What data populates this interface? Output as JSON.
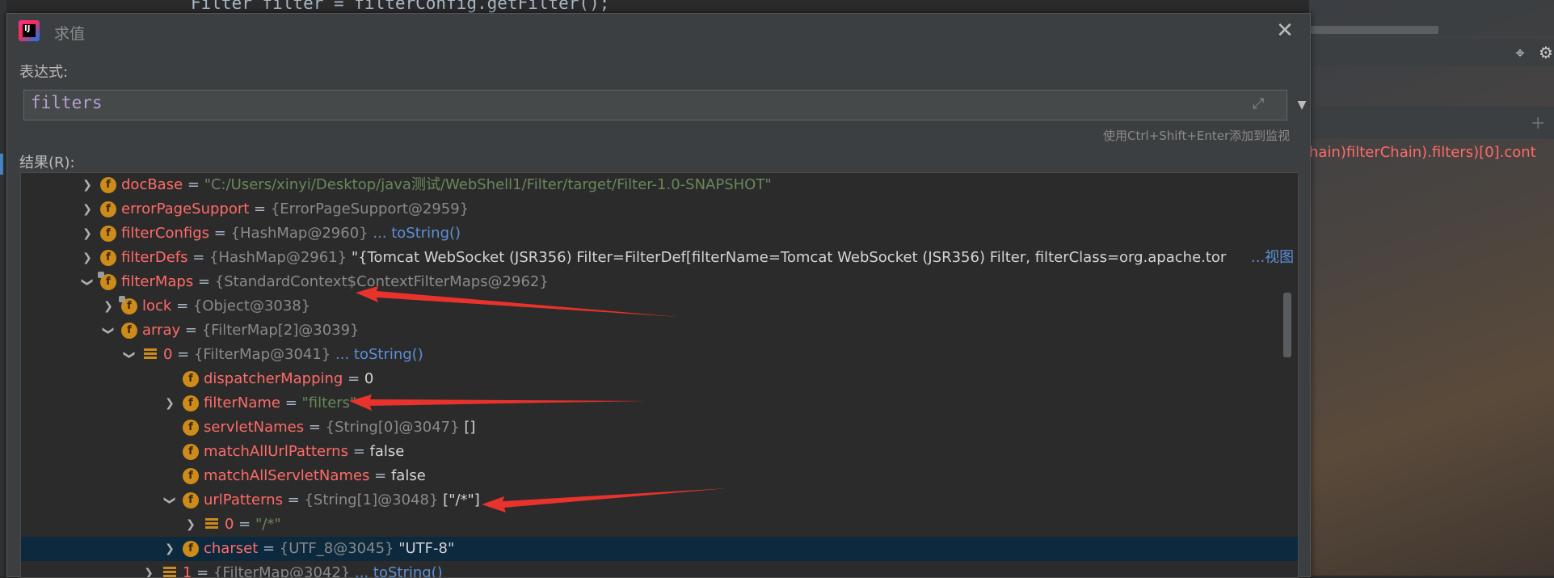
{
  "ide": {
    "code_line": "Filter filter = filterConfig.getFilter();",
    "watch_text": "hain)filterChain).filters)[0].cont"
  },
  "dialog": {
    "title": "求值",
    "expression_label": "表达式:",
    "expression_value": "filters",
    "hint": "使用Ctrl+Shift+Enter添加到监视",
    "result_label": "结果(R):"
  },
  "tree": {
    "rows": [
      {
        "name": "docBase",
        "eq": " = ",
        "type": "",
        "value": "\"C:/Users/xinyi/Desktop/java测试/WebShell1/Filter/target/Filter-1.0-SNAPSHOT\"",
        "link": ""
      },
      {
        "name": "errorPageSupport",
        "eq": " = ",
        "type": "{ErrorPageSupport@2959}",
        "value": "",
        "link": ""
      },
      {
        "name": "filterConfigs",
        "eq": " = ",
        "type": "{HashMap@2960}",
        "value": "",
        "link": "... toString()"
      },
      {
        "name": "filterDefs",
        "eq": " = ",
        "type": "{HashMap@2961}",
        "value": " \"{Tomcat WebSocket (JSR356) Filter=FilterDef[filterName=Tomcat WebSocket (JSR356) Filter, filterClass=org.apache.tor",
        "link": "...视图"
      },
      {
        "name": "filterMaps",
        "eq": " = ",
        "type": "{StandardContext$ContextFilterMaps@2962}",
        "value": "",
        "link": ""
      },
      {
        "name": "lock",
        "eq": " = ",
        "type": "{Object@3038}",
        "value": "",
        "link": ""
      },
      {
        "name": "array",
        "eq": " = ",
        "type": "{FilterMap[2]@3039}",
        "value": "",
        "link": ""
      },
      {
        "name": "0",
        "eq": " = ",
        "type": "{FilterMap@3041}",
        "value": "",
        "link": "... toString()"
      },
      {
        "name": "dispatcherMapping",
        "eq": " = ",
        "type": "",
        "value": "0",
        "link": ""
      },
      {
        "name": "filterName",
        "eq": " = ",
        "type": "",
        "value": "\"filters\"",
        "link": ""
      },
      {
        "name": "servletNames",
        "eq": " = ",
        "type": "{String[0]@3047}",
        "value": " []",
        "link": ""
      },
      {
        "name": "matchAllUrlPatterns",
        "eq": " = ",
        "type": "",
        "value": "false",
        "link": ""
      },
      {
        "name": "matchAllServletNames",
        "eq": " = ",
        "type": "",
        "value": "false",
        "link": ""
      },
      {
        "name": "urlPatterns",
        "eq": " = ",
        "type": "{String[1]@3048}",
        "value": " [\"/*\"]",
        "link": ""
      },
      {
        "name": "0",
        "eq": " = ",
        "type": "",
        "value": "\"/*\"",
        "link": ""
      },
      {
        "name": "charset",
        "eq": " = ",
        "type": "{UTF_8@3045}",
        "value": " \"UTF-8\"",
        "link": ""
      },
      {
        "name": "1",
        "eq": " = ",
        "type": "{FilterMap@3042}",
        "value": "",
        "link": "... toString()"
      }
    ]
  },
  "colors": {
    "field_name": "#ff6b68",
    "string_value": "#6a8759",
    "type_text": "#8a8a8a",
    "link": "#5c8fd6",
    "icon_field": "#cc8b1a",
    "selected_row": "#0d293e",
    "annotation_arrow": "#e8322c"
  }
}
